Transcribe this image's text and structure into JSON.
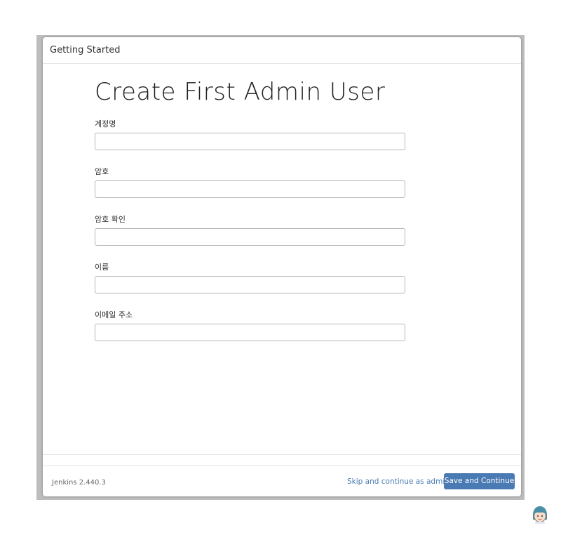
{
  "dialog": {
    "title": "Getting Started"
  },
  "main": {
    "heading": "Create First Admin User",
    "fields": [
      {
        "label": "계정명",
        "value": "",
        "placeholder": ""
      },
      {
        "label": "암호",
        "value": "",
        "placeholder": ""
      },
      {
        "label": "암호 확인",
        "value": "",
        "placeholder": ""
      },
      {
        "label": "이름",
        "value": "",
        "placeholder": ""
      },
      {
        "label": "이메일 주소",
        "value": "",
        "placeholder": ""
      }
    ]
  },
  "footer": {
    "version": "Jenkins 2.440.3",
    "skip_label": "Skip and continue as admin",
    "save_label": "Save and Continue"
  },
  "colors": {
    "accent": "#4a7ab3",
    "link": "#4a7bb0"
  },
  "icons": {
    "corner": "jenkins-mascot-icon"
  }
}
